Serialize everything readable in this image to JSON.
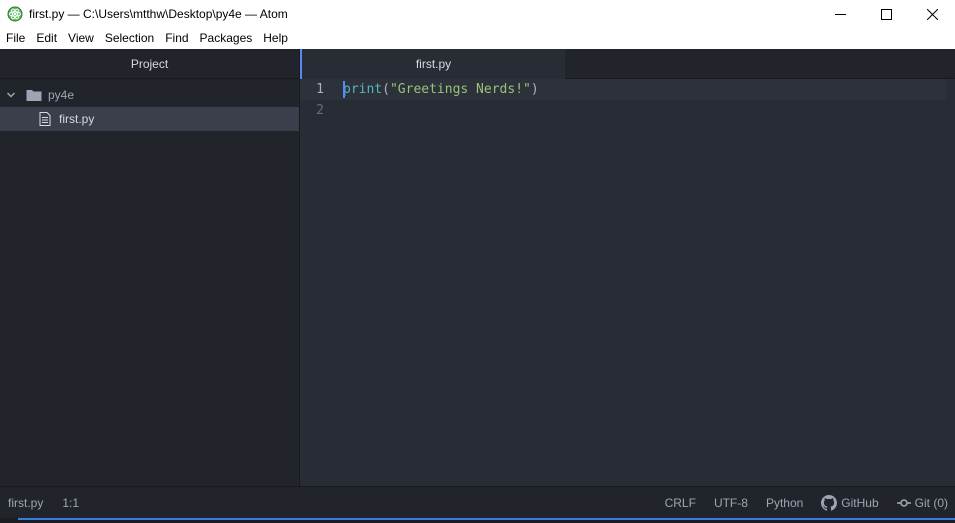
{
  "window": {
    "title": "first.py — C:\\Users\\mtthw\\Desktop\\py4e — Atom",
    "app_icon": "atom-icon",
    "controls": [
      "minimize-icon",
      "maximize-icon",
      "close-icon"
    ]
  },
  "menu": {
    "items": [
      "File",
      "Edit",
      "View",
      "Selection",
      "Find",
      "Packages",
      "Help"
    ]
  },
  "tree": {
    "header": "Project",
    "folder": {
      "name": "py4e",
      "icon": "folder-icon",
      "expanded": true
    },
    "files": [
      {
        "name": "first.py",
        "icon": "file-text-icon",
        "selected": true
      }
    ]
  },
  "editor": {
    "tab": {
      "label": "first.py",
      "active": true
    },
    "lines": [
      {
        "number": "1",
        "keyword": "print",
        "open": "(",
        "string": "\"Greetings Nerds!\"",
        "close": ")"
      },
      {
        "number": "2"
      }
    ]
  },
  "status": {
    "file": "first.py",
    "cursor": "1:1",
    "line_ending": "CRLF",
    "encoding": "UTF-8",
    "grammar": "Python",
    "github": "GitHub",
    "git": "Git (0)"
  },
  "colors": {
    "accent": "#568af2",
    "keyword": "#56b6c2",
    "string": "#98c379",
    "background": "#282c34"
  }
}
